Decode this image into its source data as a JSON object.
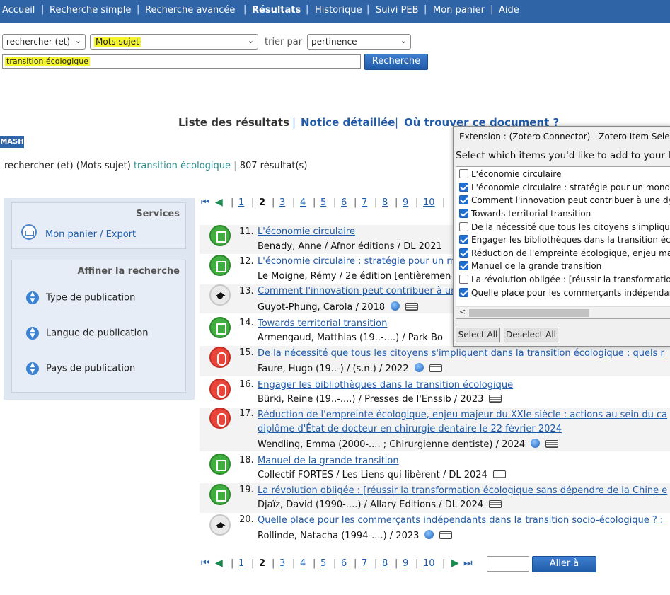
{
  "nav": {
    "items": [
      {
        "label": "Accueil"
      },
      {
        "label": "Recherche simple"
      },
      {
        "label": "Recherche avancée"
      },
      {
        "label": "Résultats"
      },
      {
        "label": "Historique"
      },
      {
        "label": "Suivi PEB"
      },
      {
        "label": "Mon panier"
      },
      {
        "label": "Aide"
      }
    ]
  },
  "search": {
    "operator": "rechercher (et)",
    "field": "Mots sujet",
    "sort_label": "trier par",
    "sort_value": "pertinence",
    "query": "transition écologique",
    "button": "Recherche"
  },
  "tabs": {
    "list": "Liste des résultats",
    "detail": "Notice détaillée",
    "where": "Où trouver ce document ?"
  },
  "mash": "MASH",
  "criteria": {
    "operator": "rechercher (et)",
    "field": "(Mots sujet)",
    "query": "transition écologique",
    "count": "807 résultat(s)"
  },
  "sidebar": {
    "services_title": "Services",
    "basket_link": "Mon panier / Export",
    "refine_title": "Affiner la recherche",
    "facets": [
      "Type de publication",
      "Langue de publication",
      "Pays de publication"
    ]
  },
  "pager": {
    "pages": [
      "1",
      "2",
      "3",
      "4",
      "5",
      "6",
      "7",
      "8",
      "9",
      "10"
    ],
    "current": "2"
  },
  "results": [
    {
      "num": "11.",
      "title": "L'économie circulaire",
      "meta": "Benady, Anne / Afnor éditions / DL 2021",
      "icon": "book-icon"
    },
    {
      "num": "12.",
      "title": "L'économie circulaire : stratégie pour un m",
      "meta": "Le Moigne, Rémy / 2e édition [entièremen",
      "icon": "book-icon"
    },
    {
      "num": "13.",
      "title": "Comment l'innovation peut contribuer à un",
      "meta": "Guyot-Phung, Carola / 2018",
      "icon": "thesis-cap-icon"
    },
    {
      "num": "14.",
      "title": "Towards territorial transition",
      "meta": "Armengaud, Matthias (19..-....) / Park Bo",
      "icon": "book-icon"
    },
    {
      "num": "15.",
      "title": "De la nécessité que tous les citoyens s'impliquent dans la transition écologique : quels r",
      "meta": "Faure, Hugo (19..-) / (s.n.) / 2022",
      "icon": "electronic-resource-icon"
    },
    {
      "num": "16.",
      "title": "Engager les bibliothèques dans la transition écologique",
      "meta": "Bürki, Reine (19..-....) / Presses de l'Enssib / 2023",
      "icon": "electronic-resource-icon"
    },
    {
      "num": "17.",
      "title": "Réduction de l'empreinte écologique, enjeu majeur du XXIe siècle : actions au sein du ca",
      "title2": "diplôme d'État de docteur en chirurgie dentaire le 22 février 2024",
      "meta": "Wendling, Emma (2000-.... ; Chirurgienne dentiste) / 2024",
      "icon": "electronic-resource-icon"
    },
    {
      "num": "18.",
      "title": "Manuel de la grande transition",
      "meta": "Collectif FORTES / Les Liens qui libèrent / DL 2024",
      "icon": "book-icon"
    },
    {
      "num": "19.",
      "title": "La révolution obligée : [réussir la transformation écologique sans dépendre de la Chine e",
      "meta": "Djaïz, David (1990-....) / Allary Editions / DL 2024",
      "icon": "book-icon"
    },
    {
      "num": "20.",
      "title": "Quelle place pour les commerçants indépendants dans la transition socio-écologique ? :",
      "meta": "Rollinde, Natacha (1994-....) / 2023",
      "icon": "thesis-cap-icon"
    }
  ],
  "goto_button": "Aller à",
  "popup": {
    "title": "Extension : (Zotero Connector) - Zotero Item Selector —",
    "prompt": "Select which items you'd like to add to your libra",
    "items": [
      {
        "label": "L'économie circulaire",
        "checked": false
      },
      {
        "label": "L'économie circulaire : stratégie pour un monde dura",
        "checked": true
      },
      {
        "label": "Comment l'innovation peut contribuer à une dynamic",
        "checked": true
      },
      {
        "label": "Towards territorial transition",
        "checked": true
      },
      {
        "label": "De la nécessité que tous les citoyens s'impliquent d",
        "checked": false
      },
      {
        "label": "Engager les bibliothèques dans la transition écolog",
        "checked": true
      },
      {
        "label": "Réduction de l'empreinte écologique, enjeu majeur",
        "checked": true
      },
      {
        "label": "Manuel de la grande transition",
        "checked": true
      },
      {
        "label": "La révolution obligée : [réussir la transformation éco",
        "checked": false
      },
      {
        "label": "Quelle place pour les commerçants indépendants d",
        "checked": true
      }
    ],
    "select_all": "Select All",
    "deselect_all": "Deselect All"
  },
  "colors": {
    "nav_bg": "#2f64a7",
    "link": "#1f5ba8",
    "highlight": "#f4f42a",
    "checkbox": "#1f6fd1"
  }
}
